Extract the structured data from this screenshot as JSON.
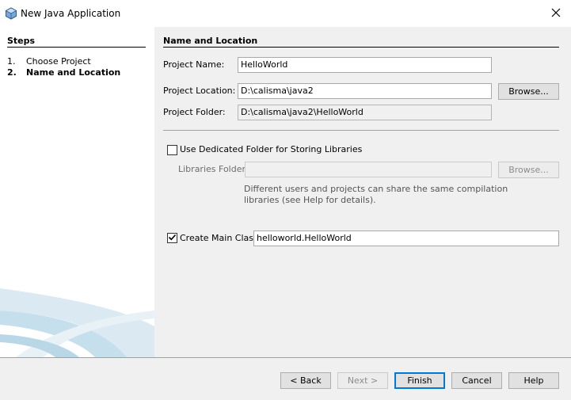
{
  "window": {
    "title": "New Java Application"
  },
  "steps": {
    "heading": "Steps",
    "items": [
      {
        "num": "1.",
        "label": "Choose Project"
      },
      {
        "num": "2.",
        "label": "Name and Location"
      }
    ]
  },
  "section": {
    "heading": "Name and Location"
  },
  "form": {
    "project_name_label": "Project Name:",
    "project_name_value": "HelloWorld",
    "project_location_label": "Project Location:",
    "project_location_value": "D:\\calisma\\java2",
    "browse_label": "Browse...",
    "project_folder_label": "Project Folder:",
    "project_folder_value": "D:\\calisma\\java2\\HelloWorld",
    "dedicated_folder_label": "Use Dedicated Folder for Storing Libraries",
    "libraries_folder_label": "Libraries Folder:",
    "libraries_folder_value": "",
    "libraries_browse_label": "Browse...",
    "help_line1": "Different users and projects can share the same compilation",
    "help_line2": "libraries (see Help for details).",
    "create_main_class_label": "Create Main Class",
    "main_class_value": "helloworld.HelloWorld"
  },
  "buttons": {
    "back": "< Back",
    "next": "Next >",
    "finish": "Finish",
    "cancel": "Cancel",
    "help": "Help"
  },
  "colors": {
    "accent": "#0078d7",
    "panel": "#f0f0f0",
    "swoosh": "#cfe3ee"
  }
}
